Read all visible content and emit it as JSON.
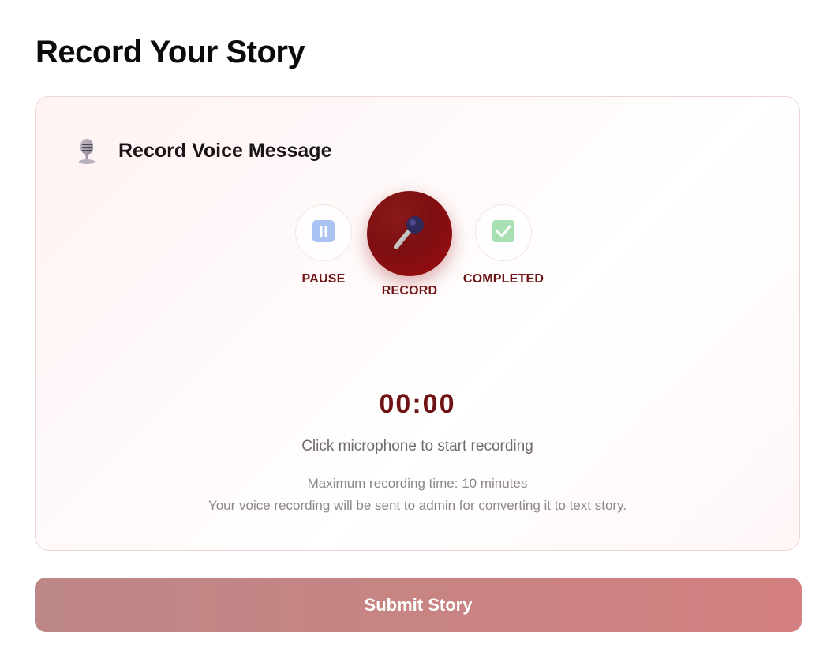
{
  "page": {
    "title": "Record Your Story"
  },
  "recorder": {
    "title": "Record Voice Message",
    "header_icon": "studio-microphone-icon",
    "controls": {
      "pause_label": "PAUSE",
      "pause_icon": "pause-icon",
      "record_label": "RECORD",
      "record_icon": "microphone-icon",
      "completed_label": "COMPLETED",
      "completed_icon": "check-icon"
    },
    "timer": "00:00",
    "hint": "Click microphone to start recording",
    "notes": [
      "Maximum recording time: 10 minutes",
      "Your voice recording will be sent to admin for converting it to text story."
    ]
  },
  "submit": {
    "label": "Submit Story"
  },
  "colors": {
    "accent": "#6e1313",
    "record_button": "#8a0f12",
    "submit_button": "#c98382",
    "pause_icon": "#a9c4f2",
    "check_icon": "#a8e0b4"
  }
}
